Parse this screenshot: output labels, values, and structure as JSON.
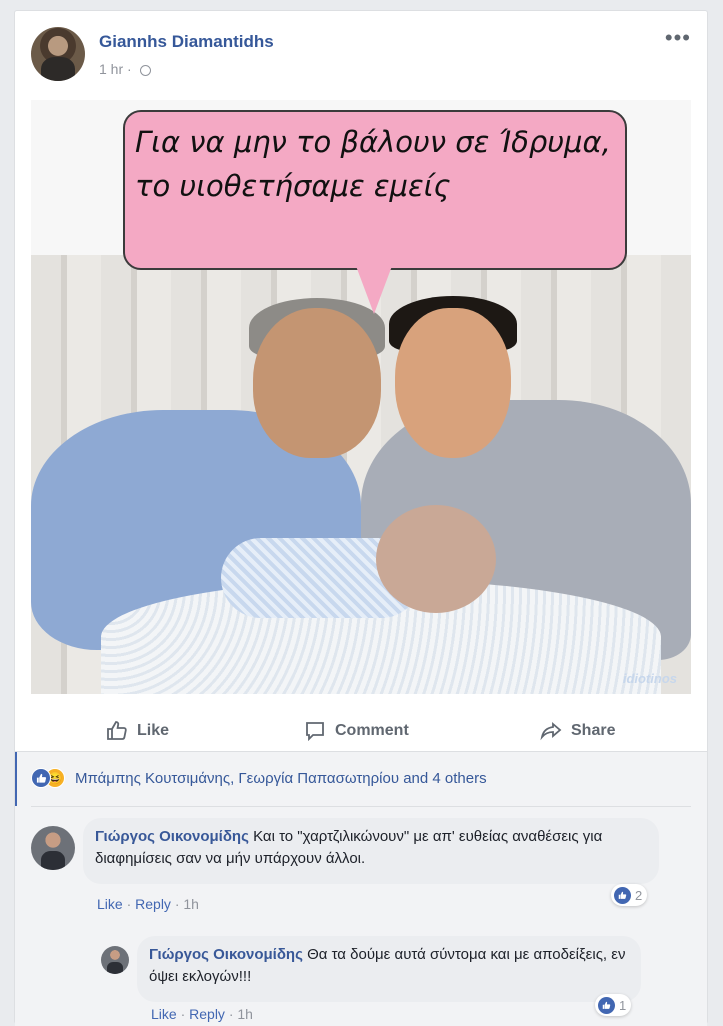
{
  "post": {
    "author": "Giannhs Diamantidhs",
    "time": "1 hr",
    "separator": "·",
    "more": "•••",
    "image": {
      "caption": "Για να μην το βάλουν σε Ίδρυμα, το υιοθετήσαμε εμείς",
      "watermark": "idiotinos"
    },
    "actions": {
      "like": "Like",
      "comment": "Comment",
      "share": "Share"
    }
  },
  "reactions": {
    "summary": "Μπάμπης Κουτσιμάνης, Γεωργία Παπασωτηρίου and 4 others"
  },
  "comments": [
    {
      "author": "Γιώργος Οικονομίδης",
      "text": "Και το \"χαρτζιλικώνουν\" με απ' ευθείας αναθέσεις για διαφημίσεις σαν να μήν υπάρχουν άλλοι.",
      "like": "Like",
      "reply": "Reply",
      "time": "1h",
      "reaction_count": "2"
    },
    {
      "author": "Γιώργος Οικονομίδης",
      "text": "Θα τα δούμε αυτά σύντομα και με αποδείξεις, εν όψει εκλογών!!!",
      "like": "Like",
      "reply": "Reply",
      "time": "1h",
      "reaction_count": "1"
    }
  ],
  "meta_separator": "·",
  "colors": {
    "link": "#365899",
    "brand": "#4267b2",
    "bubble": "#f4a9c4",
    "background": "#e9ebee"
  }
}
